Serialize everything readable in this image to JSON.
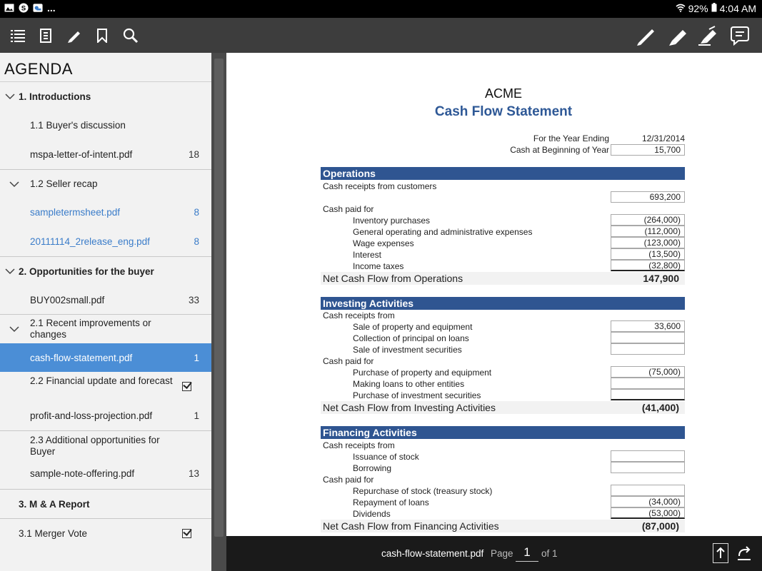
{
  "status_bar": {
    "battery": "92%",
    "time": "4:04 AM",
    "more": "..."
  },
  "toolbar": {
    "left_icons": [
      "list-icon",
      "document-icon",
      "pen-icon",
      "bookmark-icon",
      "search-icon"
    ],
    "right_icons": [
      "pencil-icon",
      "marker-icon",
      "highlighter-icon",
      "comment-icon"
    ]
  },
  "sidebar": {
    "title": "AGENDA",
    "items": [
      {
        "label": "1. Introductions",
        "level": "top",
        "chevron": true
      },
      {
        "label": "1.1 Buyer's discussion",
        "level": "sub"
      },
      {
        "label": "mspa-letter-of-intent.pdf",
        "num": "18",
        "level": "file"
      },
      {
        "label": "1.2 Seller recap",
        "level": "sub",
        "chevron": true
      },
      {
        "label": "sampletermsheet.pdf",
        "num": "8",
        "level": "file",
        "link": true
      },
      {
        "label": "20111114_2release_eng.pdf",
        "num": "8",
        "level": "file",
        "link": true
      },
      {
        "label": "2. Opportunities for the buyer",
        "level": "top",
        "chevron": true
      },
      {
        "label": "BUY002small.pdf",
        "num": "33",
        "level": "file"
      },
      {
        "label": "2.1 Recent improvements or changes",
        "level": "sub",
        "chevron": true
      },
      {
        "label": "cash-flow-statement.pdf",
        "num": "1",
        "level": "file",
        "selected": true
      },
      {
        "label": "2.2 Financial update and forecast",
        "level": "sub",
        "checkbox": true
      },
      {
        "label": "profit-and-loss-projection.pdf",
        "num": "1",
        "level": "file"
      },
      {
        "label": "2.3 Additional opportunities for Buyer",
        "level": "sub"
      },
      {
        "label": "sample-note-offering.pdf",
        "num": "13",
        "level": "file"
      },
      {
        "label": "3. M & A Report",
        "level": "top"
      },
      {
        "label": "3.1 Merger Vote",
        "level": "sub",
        "checkbox": true
      }
    ]
  },
  "document": {
    "company": "ACME",
    "title": "Cash Flow Statement",
    "year_ending_label": "For the Year Ending",
    "year_ending_value": "12/31/2014",
    "cash_begin_label": "Cash at Beginning of Year",
    "cash_begin_value": "15,700",
    "operations": {
      "header": "Operations",
      "receipts_label": "Cash receipts from customers",
      "receipts_value": "693,200",
      "paid_label": "Cash paid for",
      "paid_items": [
        {
          "label": "Inventory purchases",
          "value": "(264,000)"
        },
        {
          "label": "General operating and administrative expenses",
          "value": "(112,000)"
        },
        {
          "label": "Wage expenses",
          "value": "(123,000)"
        },
        {
          "label": "Interest",
          "value": "(13,500)"
        },
        {
          "label": "Income taxes",
          "value": "(32,800)"
        }
      ],
      "net_label": "Net Cash Flow from Operations",
      "net_value": "147,900"
    },
    "investing": {
      "header": "Investing Activities",
      "receipts_label": "Cash receipts from",
      "receipts_items": [
        {
          "label": "Sale of property and equipment",
          "value": "33,600"
        },
        {
          "label": "Collection of principal on loans",
          "value": ""
        },
        {
          "label": "Sale of investment securities",
          "value": ""
        }
      ],
      "paid_label": "Cash paid for",
      "paid_items": [
        {
          "label": "Purchase of property and equipment",
          "value": "(75,000)"
        },
        {
          "label": "Making loans to other entities",
          "value": ""
        },
        {
          "label": "Purchase of investment securities",
          "value": ""
        }
      ],
      "net_label": "Net Cash Flow from Investing Activities",
      "net_value": "(41,400)"
    },
    "financing": {
      "header": "Financing Activities",
      "receipts_label": "Cash receipts from",
      "receipts_items": [
        {
          "label": "Issuance of stock",
          "value": ""
        },
        {
          "label": "Borrowing",
          "value": ""
        }
      ],
      "paid_label": "Cash paid for",
      "paid_items": [
        {
          "label": "Repurchase of stock (treasury stock)",
          "value": ""
        },
        {
          "label": "Repayment of loans",
          "value": "(34,000)"
        },
        {
          "label": "Dividends",
          "value": "(53,000)"
        }
      ],
      "net_label": "Net Cash Flow from Financing Activities",
      "net_value": "(87,000)"
    }
  },
  "bottom_bar": {
    "filename": "cash-flow-statement.pdf",
    "page_label": "Page",
    "page_value": "1",
    "of_label": "of 1"
  }
}
